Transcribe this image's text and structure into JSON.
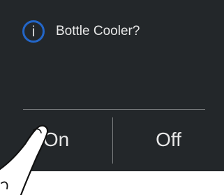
{
  "dialog": {
    "icon": "info-icon",
    "icon_glyph": "i",
    "title": "Bottle Cooler?",
    "on_label": "On",
    "off_label": "Off"
  },
  "colors": {
    "panel_background": "#23272a",
    "icon_ring": "#2366c8",
    "text": "#e8e8e8",
    "divider": "#7a7c7e"
  },
  "overlay": {
    "icon": "pointing-finger-icon"
  }
}
